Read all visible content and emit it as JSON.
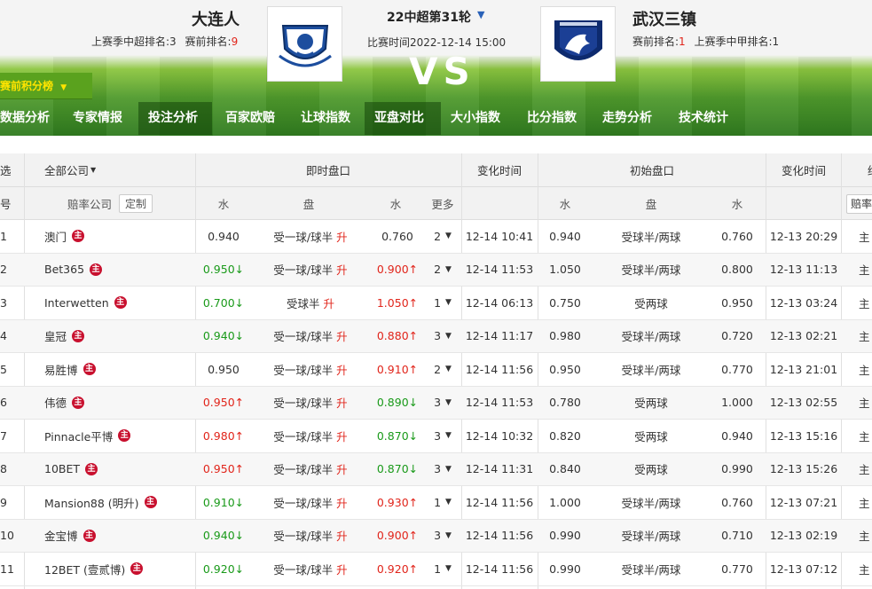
{
  "header": {
    "home_team": "大连人",
    "home_rank_prev": "上赛季中超排名:3",
    "home_rank_pre_label": "赛前排名:",
    "home_rank_pre_value": "9",
    "round": "22中超第31轮",
    "match_time": "比赛时间2022-12-14 15:00",
    "vs": "VS",
    "away_team": "武汉三镇",
    "away_rank_pre_label": "赛前排名:",
    "away_rank_pre_value": "1",
    "away_rank_prev": "上赛季中甲排名:1",
    "standings_label": "赛前积分榜"
  },
  "nav": [
    {
      "label": "数据分析",
      "active": false
    },
    {
      "label": "专家情报",
      "active": false
    },
    {
      "label": "投注分析",
      "active": true
    },
    {
      "label": "百家欧赔",
      "active": false
    },
    {
      "label": "让球指数",
      "active": false
    },
    {
      "label": "亚盘对比",
      "active": true
    },
    {
      "label": "大小指数",
      "active": false
    },
    {
      "label": "比分指数",
      "active": false
    },
    {
      "label": "走势分析",
      "active": false
    },
    {
      "label": "技术统计",
      "active": false
    }
  ],
  "table": {
    "h1": {
      "select": "选",
      "company_filter": "全部公司",
      "live": "即时盘口",
      "change_time": "变化时间",
      "initial": "初始盘口",
      "change_time2": "变化时间",
      "edge": "终"
    },
    "h2": {
      "index": "号",
      "company": "赔率公司",
      "custom": "定制",
      "water1": "水",
      "line": "盘",
      "water2": "水",
      "more": "更多",
      "init_water1": "水",
      "init_line": "盘",
      "init_water2": "水",
      "edge_btn": "赔率"
    },
    "home_badge": "主",
    "raise": "升",
    "rows": [
      {
        "no": "1",
        "company": "澳门",
        "w1": "0.940",
        "w1d": "",
        "line": "受一球/球半",
        "w2": "0.760",
        "w2d": "",
        "more": "2",
        "time": "12-14 10:41",
        "iw1": "0.940",
        "iline": "受球半/两球",
        "iw2": "0.760",
        "itime": "12-13 20:29",
        "edge": "主"
      },
      {
        "no": "2",
        "company": "Bet365",
        "w1": "0.950",
        "w1d": "down",
        "line": "受一球/球半",
        "w2": "0.900",
        "w2d": "up",
        "more": "2",
        "time": "12-14 11:53",
        "iw1": "1.050",
        "iline": "受球半/两球",
        "iw2": "0.800",
        "itime": "12-13 11:13",
        "edge": "主"
      },
      {
        "no": "3",
        "company": "Interwetten",
        "w1": "0.700",
        "w1d": "down",
        "line": "受球半",
        "w2": "1.050",
        "w2d": "up",
        "more": "1",
        "time": "12-14 06:13",
        "iw1": "0.750",
        "iline": "受两球",
        "iw2": "0.950",
        "itime": "12-13 03:24",
        "edge": "主"
      },
      {
        "no": "4",
        "company": "皇冠",
        "w1": "0.940",
        "w1d": "down",
        "line": "受一球/球半",
        "w2": "0.880",
        "w2d": "up",
        "more": "3",
        "time": "12-14 11:17",
        "iw1": "0.980",
        "iline": "受球半/两球",
        "iw2": "0.720",
        "itime": "12-13 02:21",
        "edge": "主"
      },
      {
        "no": "5",
        "company": "易胜博",
        "w1": "0.950",
        "w1d": "",
        "line": "受一球/球半",
        "w2": "0.910",
        "w2d": "up",
        "more": "2",
        "time": "12-14 11:56",
        "iw1": "0.950",
        "iline": "受球半/两球",
        "iw2": "0.770",
        "itime": "12-13 21:01",
        "edge": "主"
      },
      {
        "no": "6",
        "company": "伟德",
        "w1": "0.950",
        "w1d": "up",
        "line": "受一球/球半",
        "w2": "0.890",
        "w2d": "down",
        "more": "3",
        "time": "12-14 11:53",
        "iw1": "0.780",
        "iline": "受两球",
        "iw2": "1.000",
        "itime": "12-13 02:55",
        "edge": "主"
      },
      {
        "no": "7",
        "company": "Pinnacle平博",
        "w1": "0.980",
        "w1d": "up",
        "line": "受一球/球半",
        "w2": "0.870",
        "w2d": "down",
        "more": "3",
        "time": "12-14 10:32",
        "iw1": "0.820",
        "iline": "受两球",
        "iw2": "0.940",
        "itime": "12-13 15:16",
        "edge": "主"
      },
      {
        "no": "8",
        "company": "10BET",
        "w1": "0.950",
        "w1d": "up",
        "line": "受一球/球半",
        "w2": "0.870",
        "w2d": "down",
        "more": "3",
        "time": "12-14 11:31",
        "iw1": "0.840",
        "iline": "受两球",
        "iw2": "0.990",
        "itime": "12-13 15:26",
        "edge": "主"
      },
      {
        "no": "9",
        "company": "Mansion88 (明升)",
        "w1": "0.910",
        "w1d": "down",
        "line": "受一球/球半",
        "w2": "0.930",
        "w2d": "up",
        "more": "1",
        "time": "12-14 11:56",
        "iw1": "1.000",
        "iline": "受球半/两球",
        "iw2": "0.760",
        "itime": "12-13 07:21",
        "edge": "主"
      },
      {
        "no": "10",
        "company": "金宝博",
        "w1": "0.940",
        "w1d": "down",
        "line": "受一球/球半",
        "w2": "0.900",
        "w2d": "up",
        "more": "3",
        "time": "12-14 11:56",
        "iw1": "0.990",
        "iline": "受球半/两球",
        "iw2": "0.710",
        "itime": "12-13 02:19",
        "edge": "主"
      },
      {
        "no": "11",
        "company": "12BET (壹贰博)",
        "w1": "0.920",
        "w1d": "down",
        "line": "受一球/球半",
        "w2": "0.920",
        "w2d": "up",
        "more": "1",
        "time": "12-14 11:56",
        "iw1": "0.990",
        "iline": "受球半/两球",
        "iw2": "0.770",
        "itime": "12-13 07:12",
        "edge": "主"
      }
    ]
  }
}
